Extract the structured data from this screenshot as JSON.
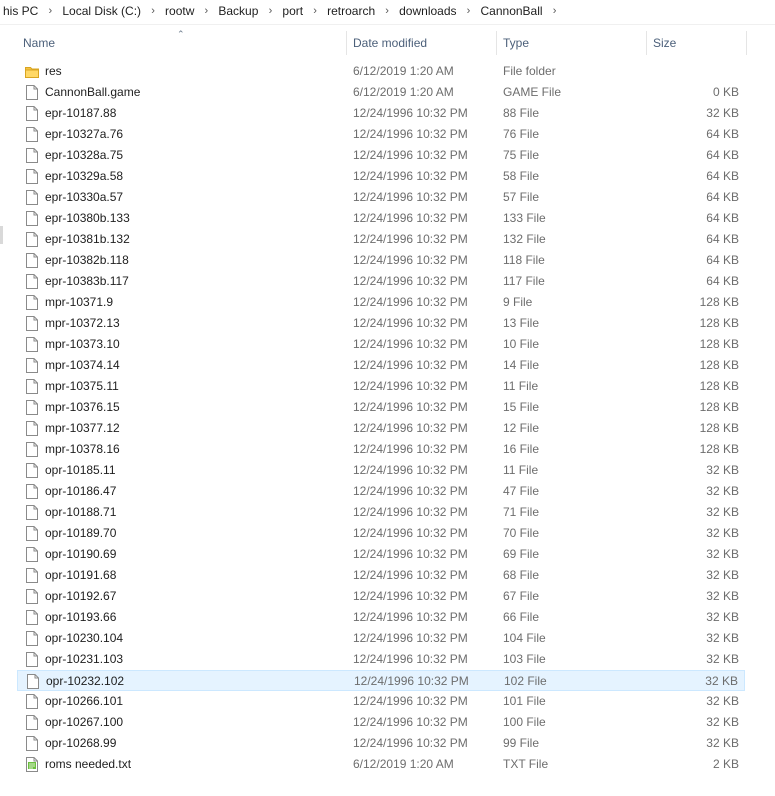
{
  "breadcrumb": [
    "his PC",
    "Local Disk (C:)",
    "rootw",
    "Backup",
    "port",
    "retroarch",
    "downloads",
    "CannonBall"
  ],
  "columns": {
    "name": "Name",
    "date": "Date modified",
    "type": "Type",
    "size": "Size"
  },
  "files": [
    {
      "name": "res",
      "date": "6/12/2019 1:20 AM",
      "type": "File folder",
      "size": "",
      "icon": "folder-icon"
    },
    {
      "name": "CannonBall.game",
      "date": "6/12/2019 1:20 AM",
      "type": "GAME File",
      "size": "0 KB",
      "icon": "file-icon"
    },
    {
      "name": "epr-10187.88",
      "date": "12/24/1996 10:32 PM",
      "type": "88 File",
      "size": "32 KB",
      "icon": "file-icon"
    },
    {
      "name": "epr-10327a.76",
      "date": "12/24/1996 10:32 PM",
      "type": "76 File",
      "size": "64 KB",
      "icon": "file-icon"
    },
    {
      "name": "epr-10328a.75",
      "date": "12/24/1996 10:32 PM",
      "type": "75 File",
      "size": "64 KB",
      "icon": "file-icon"
    },
    {
      "name": "epr-10329a.58",
      "date": "12/24/1996 10:32 PM",
      "type": "58 File",
      "size": "64 KB",
      "icon": "file-icon"
    },
    {
      "name": "epr-10330a.57",
      "date": "12/24/1996 10:32 PM",
      "type": "57 File",
      "size": "64 KB",
      "icon": "file-icon"
    },
    {
      "name": "epr-10380b.133",
      "date": "12/24/1996 10:32 PM",
      "type": "133 File",
      "size": "64 KB",
      "icon": "file-icon"
    },
    {
      "name": "epr-10381b.132",
      "date": "12/24/1996 10:32 PM",
      "type": "132 File",
      "size": "64 KB",
      "icon": "file-icon"
    },
    {
      "name": "epr-10382b.118",
      "date": "12/24/1996 10:32 PM",
      "type": "118 File",
      "size": "64 KB",
      "icon": "file-icon"
    },
    {
      "name": "epr-10383b.117",
      "date": "12/24/1996 10:32 PM",
      "type": "117 File",
      "size": "64 KB",
      "icon": "file-icon"
    },
    {
      "name": "mpr-10371.9",
      "date": "12/24/1996 10:32 PM",
      "type": "9 File",
      "size": "128 KB",
      "icon": "file-icon"
    },
    {
      "name": "mpr-10372.13",
      "date": "12/24/1996 10:32 PM",
      "type": "13 File",
      "size": "128 KB",
      "icon": "file-icon"
    },
    {
      "name": "mpr-10373.10",
      "date": "12/24/1996 10:32 PM",
      "type": "10 File",
      "size": "128 KB",
      "icon": "file-icon"
    },
    {
      "name": "mpr-10374.14",
      "date": "12/24/1996 10:32 PM",
      "type": "14 File",
      "size": "128 KB",
      "icon": "file-icon"
    },
    {
      "name": "mpr-10375.11",
      "date": "12/24/1996 10:32 PM",
      "type": "11 File",
      "size": "128 KB",
      "icon": "file-icon"
    },
    {
      "name": "mpr-10376.15",
      "date": "12/24/1996 10:32 PM",
      "type": "15 File",
      "size": "128 KB",
      "icon": "file-icon"
    },
    {
      "name": "mpr-10377.12",
      "date": "12/24/1996 10:32 PM",
      "type": "12 File",
      "size": "128 KB",
      "icon": "file-icon"
    },
    {
      "name": "mpr-10378.16",
      "date": "12/24/1996 10:32 PM",
      "type": "16 File",
      "size": "128 KB",
      "icon": "file-icon"
    },
    {
      "name": "opr-10185.11",
      "date": "12/24/1996 10:32 PM",
      "type": "11 File",
      "size": "32 KB",
      "icon": "file-icon"
    },
    {
      "name": "opr-10186.47",
      "date": "12/24/1996 10:32 PM",
      "type": "47 File",
      "size": "32 KB",
      "icon": "file-icon"
    },
    {
      "name": "opr-10188.71",
      "date": "12/24/1996 10:32 PM",
      "type": "71 File",
      "size": "32 KB",
      "icon": "file-icon"
    },
    {
      "name": "opr-10189.70",
      "date": "12/24/1996 10:32 PM",
      "type": "70 File",
      "size": "32 KB",
      "icon": "file-icon"
    },
    {
      "name": "opr-10190.69",
      "date": "12/24/1996 10:32 PM",
      "type": "69 File",
      "size": "32 KB",
      "icon": "file-icon"
    },
    {
      "name": "opr-10191.68",
      "date": "12/24/1996 10:32 PM",
      "type": "68 File",
      "size": "32 KB",
      "icon": "file-icon"
    },
    {
      "name": "opr-10192.67",
      "date": "12/24/1996 10:32 PM",
      "type": "67 File",
      "size": "32 KB",
      "icon": "file-icon"
    },
    {
      "name": "opr-10193.66",
      "date": "12/24/1996 10:32 PM",
      "type": "66 File",
      "size": "32 KB",
      "icon": "file-icon"
    },
    {
      "name": "opr-10230.104",
      "date": "12/24/1996 10:32 PM",
      "type": "104 File",
      "size": "32 KB",
      "icon": "file-icon"
    },
    {
      "name": "opr-10231.103",
      "date": "12/24/1996 10:32 PM",
      "type": "103 File",
      "size": "32 KB",
      "icon": "file-icon"
    },
    {
      "name": "opr-10232.102",
      "date": "12/24/1996 10:32 PM",
      "type": "102 File",
      "size": "32 KB",
      "icon": "file-icon",
      "selected": true
    },
    {
      "name": "opr-10266.101",
      "date": "12/24/1996 10:32 PM",
      "type": "101 File",
      "size": "32 KB",
      "icon": "file-icon"
    },
    {
      "name": "opr-10267.100",
      "date": "12/24/1996 10:32 PM",
      "type": "100 File",
      "size": "32 KB",
      "icon": "file-icon"
    },
    {
      "name": "opr-10268.99",
      "date": "12/24/1996 10:32 PM",
      "type": "99 File",
      "size": "32 KB",
      "icon": "file-icon"
    },
    {
      "name": "roms needed.txt",
      "date": "6/12/2019 1:20 AM",
      "type": "TXT File",
      "size": "2 KB",
      "icon": "text-file-icon"
    }
  ],
  "colors": {
    "header_text": "#4c607a",
    "selection_bg": "#e5f3ff",
    "selection_border": "#cce8ff",
    "folder": "#f5c342",
    "muted_text": "#6d6d6d"
  }
}
